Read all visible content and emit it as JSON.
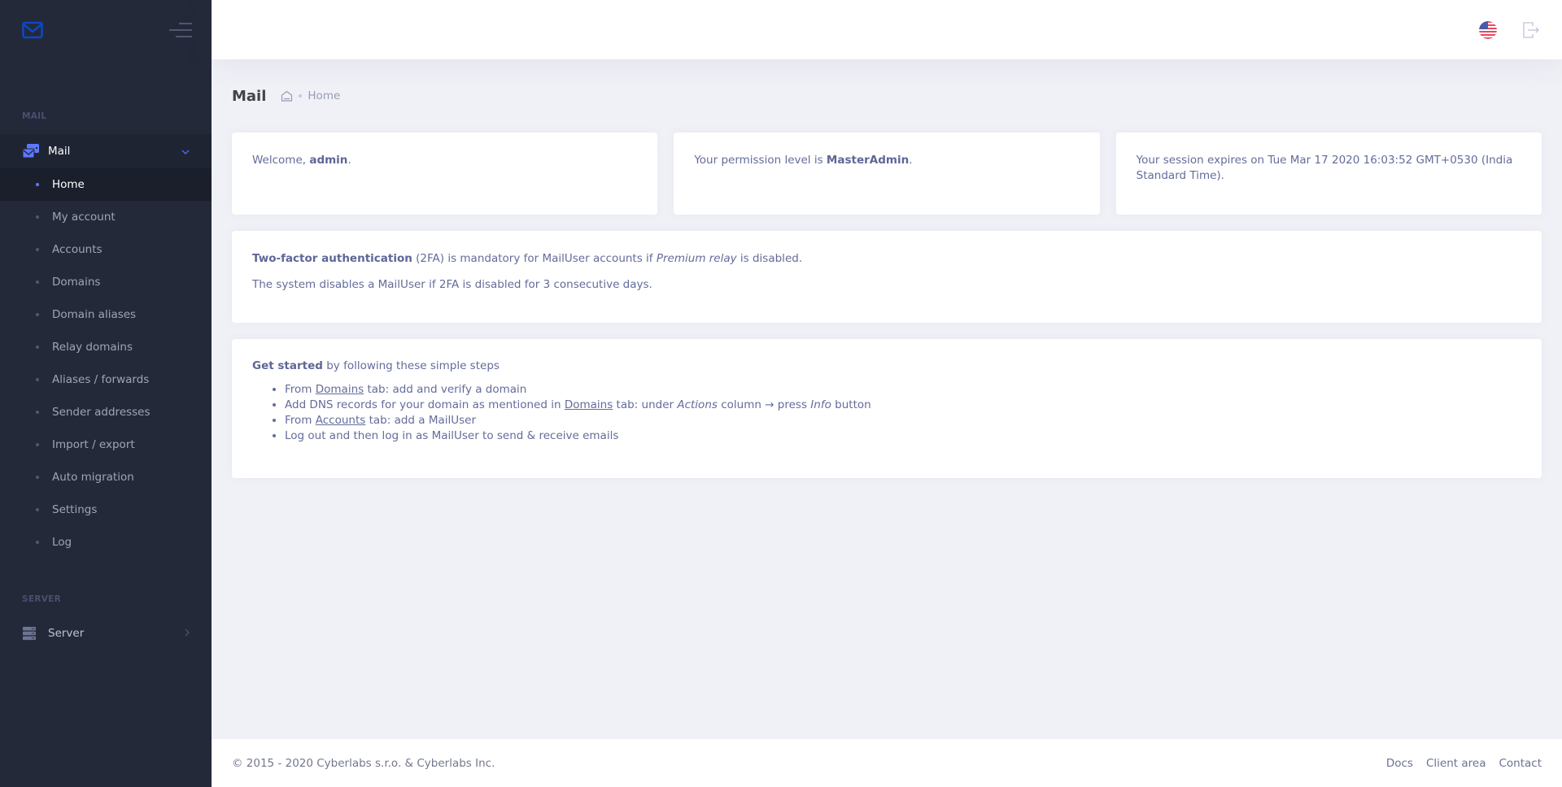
{
  "sidebar": {
    "sections": [
      {
        "label": "MAIL"
      },
      {
        "label": "SERVER"
      }
    ],
    "mail_menu": {
      "label": "Mail",
      "icon": "mail-stack-icon",
      "expanded": true,
      "items": [
        {
          "label": "Home",
          "active": true
        },
        {
          "label": "My account"
        },
        {
          "label": "Accounts"
        },
        {
          "label": "Domains"
        },
        {
          "label": "Domain aliases"
        },
        {
          "label": "Relay domains"
        },
        {
          "label": "Aliases / forwards"
        },
        {
          "label": "Sender addresses"
        },
        {
          "label": "Import / export"
        },
        {
          "label": "Auto migration"
        },
        {
          "label": "Settings"
        },
        {
          "label": "Log"
        }
      ]
    },
    "server_menu": {
      "label": "Server",
      "icon": "server-icon"
    }
  },
  "topbar": {
    "language_icon": "us-flag-icon",
    "logout_icon": "logout-icon"
  },
  "subheader": {
    "title": "Mail",
    "breadcrumb": [
      "Home"
    ]
  },
  "cards": {
    "welcome": {
      "prefix": "Welcome, ",
      "user": "admin",
      "suffix": "."
    },
    "permission": {
      "prefix": "Your permission level is ",
      "level": "MasterAdmin",
      "suffix": "."
    },
    "session": {
      "text": "Your session expires on Tue Mar 17 2020 16:03:52 GMT+0530 (India Standard Time)."
    },
    "twofa": {
      "bold": "Two-factor authentication",
      "part1": " (2FA) is mandatory for MailUser accounts if ",
      "italic": "Premium relay",
      "part2": " is disabled.",
      "line2": "The system disables a MailUser if 2FA is disabled for 3 consecutive days."
    },
    "get_started": {
      "bold": "Get started",
      "rest": " by following these simple steps",
      "steps": [
        {
          "pre": "From ",
          "link": "Domains",
          "post": " tab: add and verify a domain"
        },
        {
          "pre": "Add DNS records for your domain as mentioned in ",
          "link": "Domains",
          "mid": " tab: under ",
          "italic1": "Actions",
          "mid2": " column → press ",
          "italic2": "Info",
          "post": " button"
        },
        {
          "pre": "From ",
          "link": "Accounts",
          "post": " tab: add a MailUser"
        },
        {
          "text": "Log out and then log in as MailUser to send & receive emails"
        }
      ]
    }
  },
  "footer": {
    "copyright": "© 2015 - 2020 Cyberlabs s.r.o. & Cyberlabs Inc.",
    "links": [
      "Docs",
      "Client area",
      "Contact"
    ]
  },
  "colors": {
    "sidebar_bg": "#242939",
    "accent": "#5d78ff",
    "page_bg": "#f0f1f7",
    "text": "#646c9a"
  }
}
